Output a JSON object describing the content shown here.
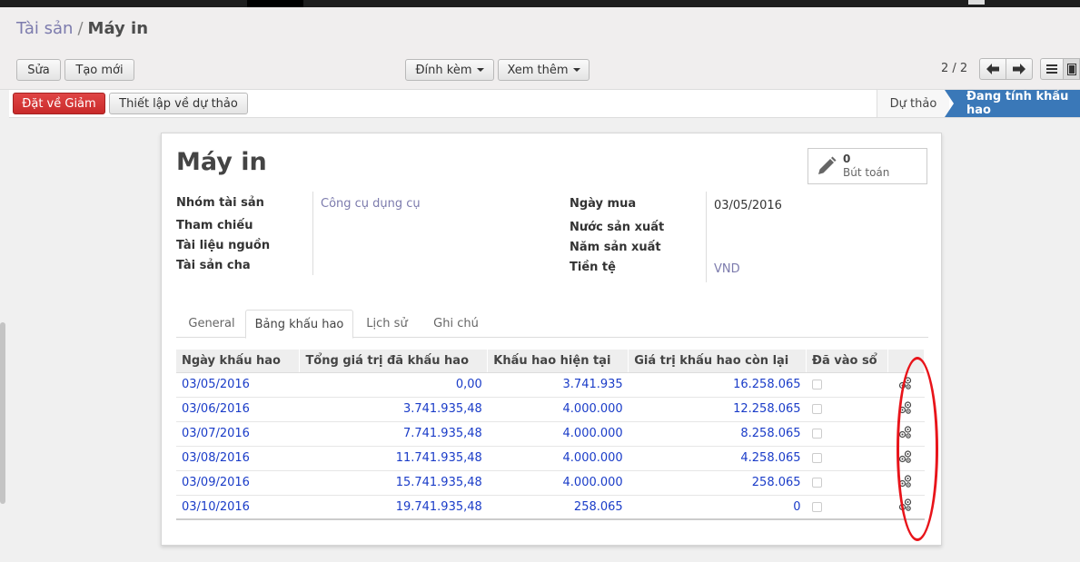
{
  "breadcrumb": {
    "parent": "Tài sản",
    "separator": "/",
    "current": "Máy in"
  },
  "toolbar": {
    "edit_label": "Sửa",
    "create_label": "Tạo mới",
    "attach_label": "Đính kèm",
    "more_label": "Xem thêm"
  },
  "pager": {
    "text": "2 / 2"
  },
  "statusbar": {
    "set_to_close_label": "Đặt về Giảm",
    "set_to_draft_label": "Thiết lập về dự thảo",
    "stages": {
      "draft": "Dự thảo",
      "open": "Đang tính khấu hao"
    }
  },
  "asset": {
    "name": "Máy in",
    "entries_count": "0",
    "entries_label": "Bút toán",
    "fields_left": {
      "category_label": "Nhóm tài sản",
      "category_value": "Công cụ dụng cụ",
      "reference_label": "Tham chiếu",
      "source_doc_label": "Tài liệu nguồn",
      "parent_label": "Tài sản cha"
    },
    "fields_right": {
      "purchase_date_label": "Ngày mua",
      "purchase_date_value": "03/05/2016",
      "origin_country_label": "Nước sản xuất",
      "year_label": "Năm sản xuất",
      "currency_label": "Tiền tệ",
      "currency_value": "VND"
    }
  },
  "tabs": [
    "General",
    "Bảng khấu hao",
    "Lịch sử",
    "Ghi chú"
  ],
  "table": {
    "headers": [
      "Ngày khấu hao",
      "Tổng giá trị đã khấu hao",
      "Khấu hao hiện tại",
      "Giá trị khấu hao còn lại",
      "Đã vào sổ"
    ],
    "rows": [
      [
        "03/05/2016",
        "0,00",
        "3.741.935",
        "16.258.065"
      ],
      [
        "03/06/2016",
        "3.741.935,48",
        "4.000.000",
        "12.258.065"
      ],
      [
        "03/07/2016",
        "7.741.935,48",
        "4.000.000",
        "8.258.065"
      ],
      [
        "03/08/2016",
        "11.741.935,48",
        "4.000.000",
        "4.258.065"
      ],
      [
        "03/09/2016",
        "15.741.935,48",
        "4.000.000",
        "258.065"
      ],
      [
        "03/10/2016",
        "19.741.935,48",
        "258.065",
        "0"
      ]
    ]
  },
  "colors": {
    "accent": "#7c7bad",
    "link_blue": "#1a3cc8",
    "red_button": "#d33232",
    "stage_active": "#3a78b8",
    "annotation": "#e8141a"
  },
  "icons": {
    "edit": "pencil-icon",
    "row_action": "gears-icon",
    "prev": "arrow-left-icon",
    "next": "arrow-right-icon",
    "list": "list-view-icon",
    "form": "form-view-icon"
  }
}
